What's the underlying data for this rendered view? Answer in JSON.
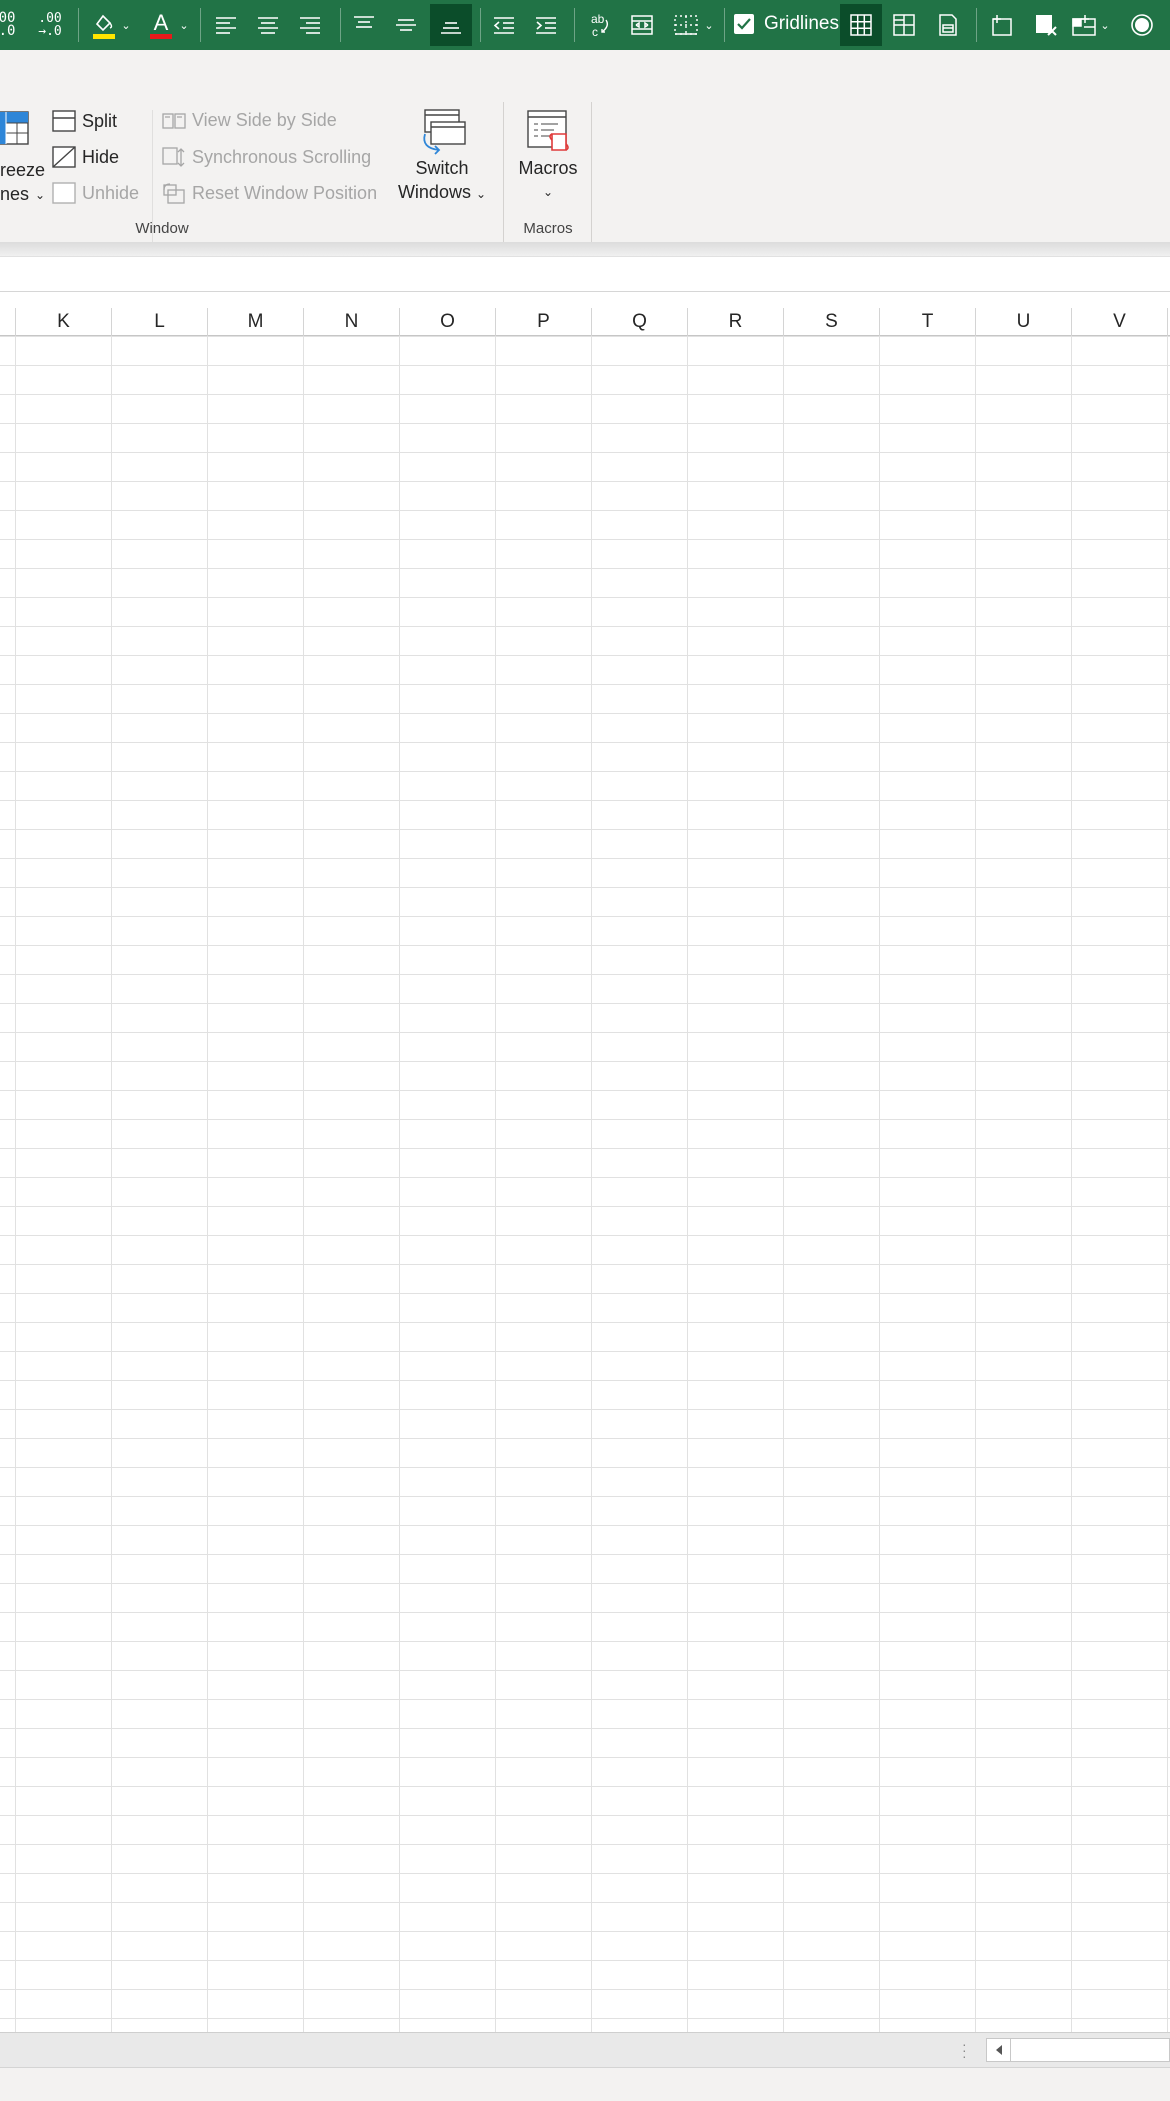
{
  "toolbar": {
    "gridlines_label": "Gridlines",
    "gridlines_checked": true,
    "active_alignment": "bottom-align",
    "accent_color": "#217346",
    "active_button_color": "#0b4d2a",
    "icons": [
      "decrease-decimal-icon",
      "increase-decimal-icon",
      "fill-color-icon",
      "font-color-icon",
      "align-left-icon",
      "align-center-icon",
      "align-right-icon",
      "top-align-icon",
      "middle-align-icon",
      "bottom-align-icon",
      "decrease-indent-icon",
      "increase-indent-icon",
      "wrap-text-icon",
      "merge-cells-icon",
      "borders-icon",
      "gridlines-checkbox",
      "view-grid-icon",
      "page-layout-icon",
      "print-preview-icon",
      "insert-sheet-icon",
      "delete-sheet-icon",
      "freeze-options-icon",
      "circle-icon"
    ]
  },
  "ribbon": {
    "window_group": {
      "label": "Window",
      "freeze_panes_partial_top": "reeze",
      "freeze_panes_partial_bottom": "nes",
      "split_label": "Split",
      "hide_label": "Hide",
      "unhide_label": "Unhide",
      "view_side_by_side_label": "View Side by Side",
      "synchronous_scrolling_label": "Synchronous Scrolling",
      "reset_window_position_label": "Reset Window Position",
      "switch_windows_line1": "Switch",
      "switch_windows_line2": "Windows"
    },
    "macros_group": {
      "label": "Macros",
      "macros_button_label": "Macros"
    }
  },
  "grid": {
    "columns": [
      "K",
      "L",
      "M",
      "N",
      "O",
      "P",
      "Q",
      "R",
      "S",
      "T",
      "U",
      "V"
    ]
  }
}
